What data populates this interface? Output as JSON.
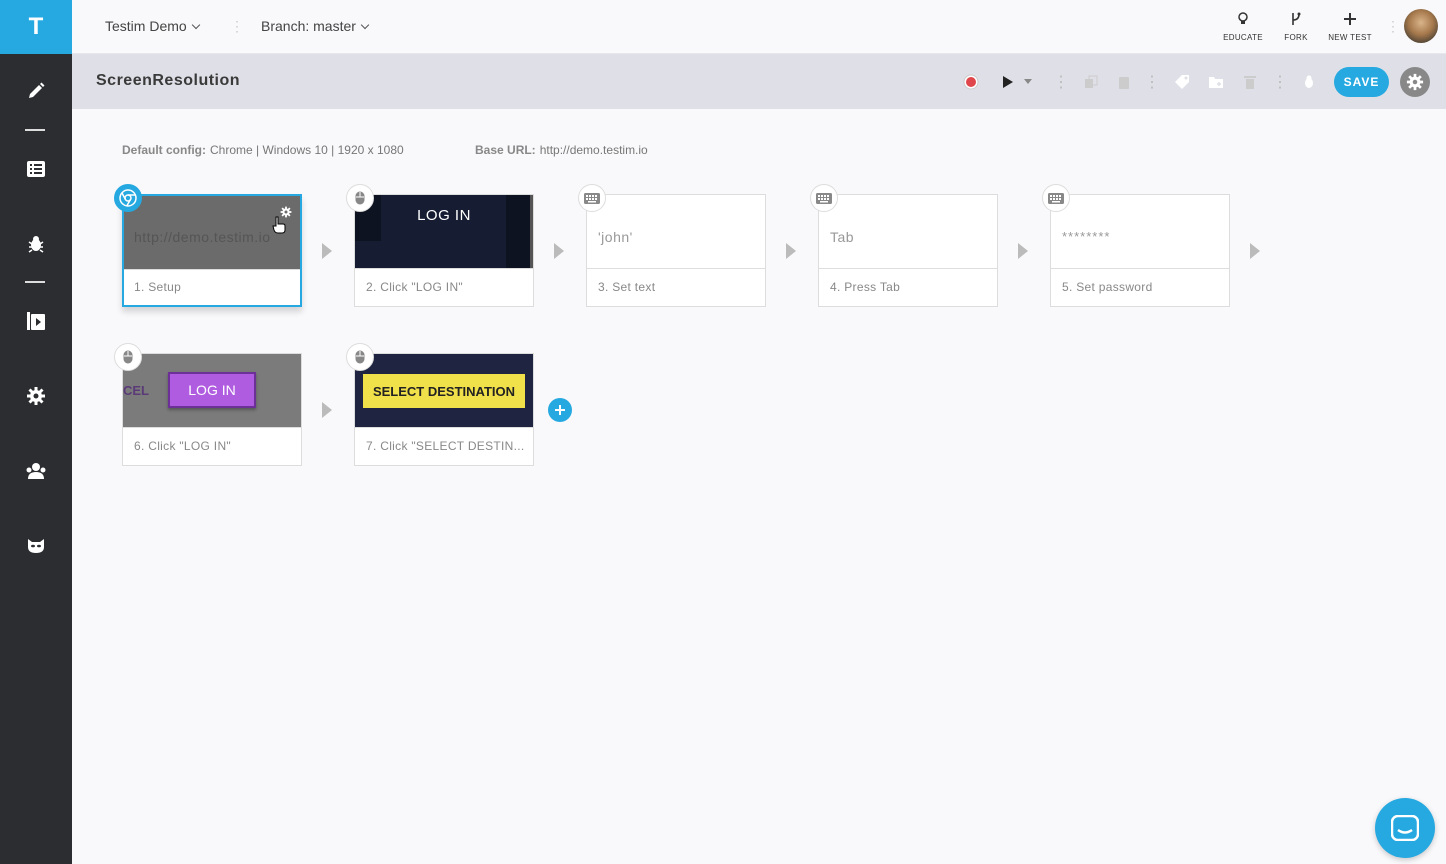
{
  "sidebar": {
    "logo": "T",
    "items": [
      {
        "icon": "pencil-icon"
      },
      {
        "icon": "list-icon"
      },
      {
        "icon": "bug-icon"
      },
      {
        "icon": "play-box-icon"
      },
      {
        "icon": "gear-icon"
      },
      {
        "icon": "team-icon"
      },
      {
        "icon": "mask-icon"
      }
    ]
  },
  "topbar": {
    "project": "Testim Demo",
    "branch": "Branch: master",
    "actions": [
      {
        "label": "EDUCATE",
        "icon": "lightbulb-icon"
      },
      {
        "label": "FORK",
        "icon": "fork-icon"
      },
      {
        "label": "NEW TEST",
        "icon": "plus-icon"
      }
    ]
  },
  "titlebar": {
    "title": "ScreenResolution",
    "save_label": "SAVE"
  },
  "config": {
    "default_label": "Default config:",
    "default_value": "Chrome | Windows 10 | 1920 x 1080",
    "base_label": "Base URL:",
    "base_value": "http://demo.testim.io"
  },
  "steps": [
    {
      "name": "1. Setup",
      "thumb": "http://demo.testim.io",
      "icon": "chrome-icon"
    },
    {
      "name": "2. Click \"LOG IN\"",
      "thumb": "LOG IN",
      "icon": "mouse-icon"
    },
    {
      "name": "3. Set text",
      "thumb": "'john'",
      "icon": "keyboard-icon"
    },
    {
      "name": "4. Press Tab",
      "thumb": "Tab",
      "icon": "keyboard-icon"
    },
    {
      "name": "5. Set password",
      "thumb": "********",
      "icon": "keyboard-icon"
    },
    {
      "name": "6. Click \"LOG IN\"",
      "thumb": "LOG IN",
      "thumb_side": "CEL",
      "icon": "mouse-icon"
    },
    {
      "name": "7. Click \"SELECT DESTIN...",
      "thumb": "SELECT DESTINATION",
      "icon": "mouse-icon"
    }
  ],
  "colors": {
    "accent": "#26a9e0",
    "sidebar": "#2b2d30",
    "record": "#e0474c",
    "purple_button": "#b05ce0",
    "yellow_button": "#f0e04a"
  }
}
